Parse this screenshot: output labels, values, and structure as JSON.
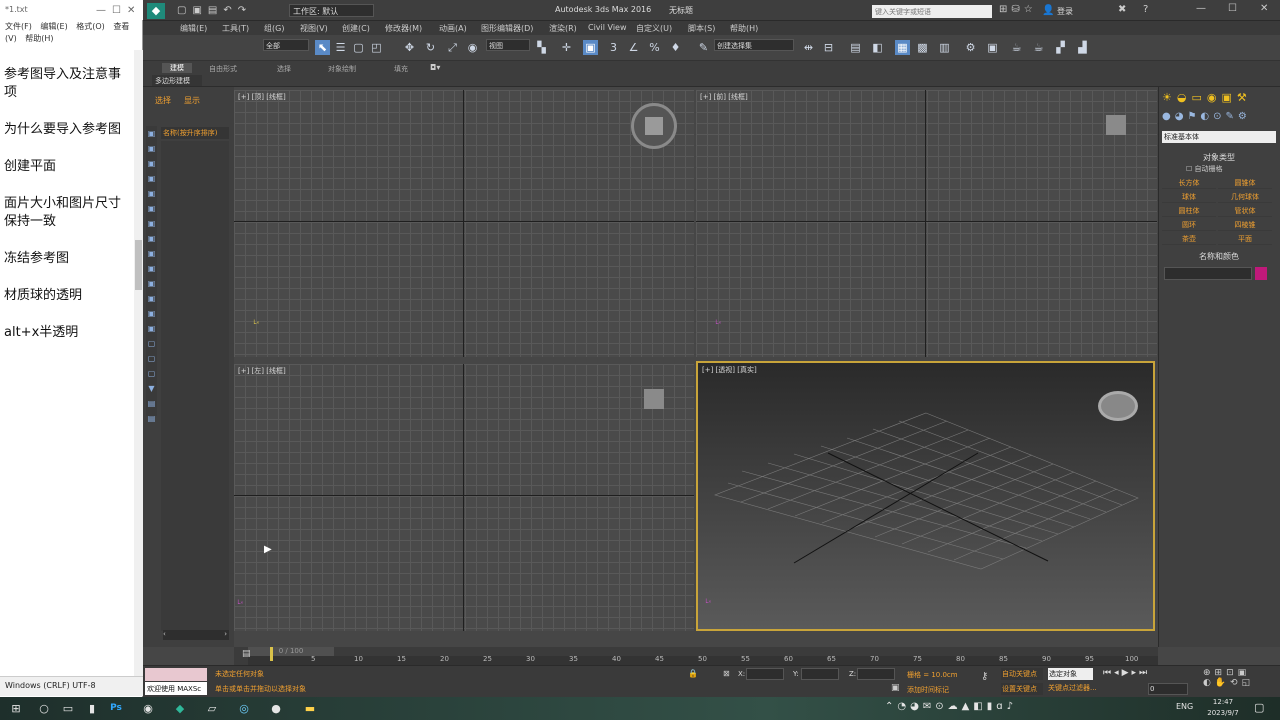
{
  "notepad": {
    "title": "*1.txt",
    "menu": [
      "文件(F)",
      "编辑(E)",
      "格式(O)",
      "查看(V)",
      "帮助(H)"
    ],
    "lines": [
      "参考图导入及注意事项",
      "为什么要导入参考图",
      "创建平面",
      "面片大小和图片尺寸保持一致",
      "冻结参考图",
      "材质球的透明",
      "alt+x半透明"
    ],
    "status": "Windows (CRLF)  UTF-8"
  },
  "max": {
    "workspace": "工作区: 默认",
    "title": "Autodesk 3ds Max 2016",
    "doc": "无标题",
    "search_placeholder": "键入关键字或短语",
    "login": "登录",
    "menus": [
      "编辑(E)",
      "工具(T)",
      "组(G)",
      "视图(V)",
      "创建(C)",
      "修改器(M)",
      "动画(A)",
      "图形编辑器(D)",
      "渲染(R)",
      "Civil View",
      "自定义(U)",
      "脚本(S)",
      "帮助(H)"
    ],
    "selection_filter": "全部",
    "ref_coord": "视图",
    "selection_set": "创建选择集",
    "ribbon_tabs": [
      "建模",
      "自由形式",
      "选择",
      "对象绘制",
      "填充"
    ],
    "ribbon_sub": "多边形建模",
    "scene_tabs": [
      "选择",
      "显示"
    ],
    "scene_header": "名称(按升序排序)",
    "viewports": [
      {
        "label": "[+] [顶] [线框]"
      },
      {
        "label": "[+] [前] [线框]"
      },
      {
        "label": "[+] [左] [线框]"
      },
      {
        "label": "[+] [透视] [真实]"
      }
    ],
    "command_panel": {
      "category": "标准基本体",
      "rollout_object_type": "对象类型",
      "autogrid": "自动栅格",
      "buttons": [
        "长方体",
        "圆锥体",
        "球体",
        "几何球体",
        "圆柱体",
        "管状体",
        "圆环",
        "四棱锥",
        "茶壶",
        "平面"
      ],
      "rollout_name_color": "名称和颜色",
      "color": "#c0197a"
    },
    "timeline": {
      "frame": "0 / 100",
      "ticks": [
        "5",
        "10",
        "15",
        "20",
        "25",
        "30",
        "35",
        "40",
        "45",
        "50",
        "55",
        "60",
        "65",
        "70",
        "75",
        "80",
        "85",
        "90",
        "95",
        "100"
      ]
    },
    "status": {
      "welcome": "欢迎使用 MAXSc",
      "line1": "未选定任何对象",
      "line2": "单击或单击并拖动以选择对象",
      "grid": "栅格 = 10.0cm",
      "add_tag": "添加时间标记",
      "auto_key": "自动关键点",
      "set_key": "设置关键点",
      "selected_obj": "选定对象",
      "key_filter": "关键点过滤器...",
      "x_label": "X:",
      "y_label": "Y:",
      "z_label": "Z:",
      "frame_value": "0"
    }
  },
  "taskbar": {
    "lang": "ENG",
    "time": "12:47",
    "date": "2023/9/7"
  }
}
